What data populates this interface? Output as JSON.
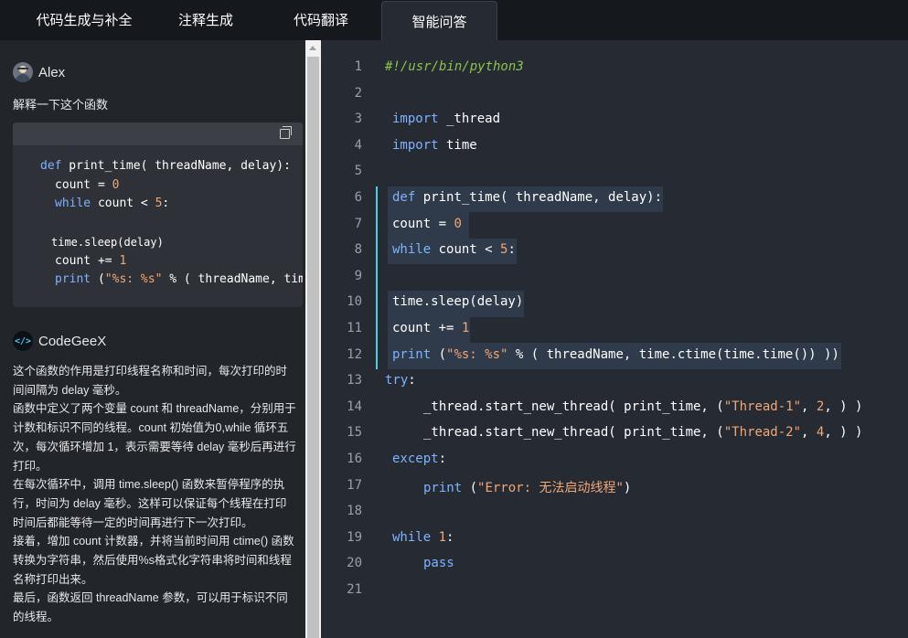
{
  "tabs": [
    {
      "label": "代码生成与补全",
      "active": false
    },
    {
      "label": "注释生成",
      "active": false
    },
    {
      "label": "代码翻译",
      "active": false
    },
    {
      "label": "智能问答",
      "active": true
    }
  ],
  "chat": {
    "user_name": "Alex",
    "question": "解释一下这个函数",
    "assistant_name": "CodeGeeX",
    "assistant_icon_text": "</>",
    "snippet_lines": [
      {
        "tokens": [
          {
            "t": "def",
            "c": "k"
          },
          {
            "t": " print_time( threadName, delay):",
            "c": "white"
          }
        ]
      },
      {
        "tokens": [
          {
            "t": "count = ",
            "c": "white"
          },
          {
            "t": "0",
            "c": "n"
          }
        ]
      },
      {
        "tokens": [
          {
            "t": "while",
            "c": "k"
          },
          {
            "t": " count < ",
            "c": "white"
          },
          {
            "t": "5",
            "c": "n"
          },
          {
            "t": ":",
            "c": "white"
          }
        ]
      },
      {
        "tokens": [
          {
            "t": "time.sleep(delay)",
            "c": "white"
          }
        ]
      },
      {
        "tokens": [
          {
            "t": "count += ",
            "c": "white"
          },
          {
            "t": "1",
            "c": "n"
          }
        ]
      },
      {
        "tokens": [
          {
            "t": "print",
            "c": "k"
          },
          {
            "t": " (",
            "c": "white"
          },
          {
            "t": "\"%s: %s\"",
            "c": "s"
          },
          {
            "t": " % ( threadName, time.ctime(time.time()) ))",
            "c": "white"
          }
        ]
      }
    ],
    "answer": [
      "这个函数的作用是打印线程名称和时间，每次打印的时间间隔为 delay 毫秒。",
      "函数中定义了两个变量 count 和 threadName，分别用于计数和标识不同的线程。count 初始值为0,while 循环五次，每次循环增加 1，表示需要等待 delay 毫秒后再进行打印。",
      "在每次循环中，调用 time.sleep() 函数来暂停程序的执行，时间为 delay 毫秒。这样可以保证每个线程在打印时间后都能等待一定的时间再进行下一次打印。",
      "接着，增加 count 计数器，并将当前时间用 ctime() 函数转换为字符串，然后使用%s格式化字符串将时间和线程名称打印出来。",
      "最后，函数返回 threadName 参数，可以用于标识不同的线程。"
    ]
  },
  "editor": {
    "lines": [
      {
        "num": "1",
        "tokens": [
          {
            "t": "#!/usr/bin/python3",
            "c": "c"
          }
        ]
      },
      {
        "num": "2",
        "tokens": []
      },
      {
        "num": "3",
        "tokens": [
          {
            "t": "import",
            "c": "k"
          },
          {
            "t": " _thread",
            "c": "white"
          }
        ]
      },
      {
        "num": "4",
        "tokens": [
          {
            "t": "import",
            "c": "k"
          },
          {
            "t": " time",
            "c": "white"
          }
        ]
      },
      {
        "num": "5",
        "tokens": []
      },
      {
        "num": "6",
        "tokens": [
          {
            "t": "def",
            "c": "k"
          },
          {
            "t": " print_time( threadName, delay):",
            "c": "white"
          }
        ]
      },
      {
        "num": "7",
        "tokens": [
          {
            "t": "count = ",
            "c": "white"
          },
          {
            "t": "0",
            "c": "n"
          }
        ]
      },
      {
        "num": "8",
        "tokens": [
          {
            "t": "while",
            "c": "k"
          },
          {
            "t": " count < ",
            "c": "white"
          },
          {
            "t": "5",
            "c": "n"
          },
          {
            "t": ":",
            "c": "white"
          }
        ]
      },
      {
        "num": "9",
        "tokens": []
      },
      {
        "num": "10",
        "tokens": [
          {
            "t": "time.sleep(delay)",
            "c": "white"
          }
        ]
      },
      {
        "num": "11",
        "tokens": [
          {
            "t": "count += ",
            "c": "white"
          },
          {
            "t": "1",
            "c": "n"
          }
        ]
      },
      {
        "num": "12",
        "tokens": [
          {
            "t": "print",
            "c": "k"
          },
          {
            "t": " (",
            "c": "white"
          },
          {
            "t": "\"%s: %s\"",
            "c": "s"
          },
          {
            "t": " % ( threadName, time.ctime(time.time()) ))",
            "c": "white"
          }
        ]
      },
      {
        "num": "13",
        "tokens": [
          {
            "t": "try",
            "c": "k"
          },
          {
            "t": ":",
            "c": "white"
          }
        ]
      },
      {
        "num": "14",
        "tokens": [
          {
            "t": "_thread.start_new_thread( print_time, (",
            "c": "white"
          },
          {
            "t": "\"Thread-1\"",
            "c": "s"
          },
          {
            "t": ", ",
            "c": "white"
          },
          {
            "t": "2",
            "c": "n"
          },
          {
            "t": ", ) )",
            "c": "white"
          }
        ]
      },
      {
        "num": "15",
        "tokens": [
          {
            "t": "_thread.start_new_thread( print_time, (",
            "c": "white"
          },
          {
            "t": "\"Thread-2\"",
            "c": "s"
          },
          {
            "t": ", ",
            "c": "white"
          },
          {
            "t": "4",
            "c": "n"
          },
          {
            "t": ", ) )",
            "c": "white"
          }
        ]
      },
      {
        "num": "16",
        "tokens": [
          {
            "t": "except",
            "c": "k"
          },
          {
            "t": ":",
            "c": "white"
          }
        ]
      },
      {
        "num": "17",
        "tokens": [
          {
            "t": "print",
            "c": "k"
          },
          {
            "t": " (",
            "c": "white"
          },
          {
            "t": "\"Error: 无法启动线程\"",
            "c": "s"
          },
          {
            "t": ")",
            "c": "white"
          }
        ]
      },
      {
        "num": "18",
        "tokens": []
      },
      {
        "num": "19",
        "tokens": [
          {
            "t": "while",
            "c": "k"
          },
          {
            "t": " ",
            "c": "white"
          },
          {
            "t": "1",
            "c": "n"
          },
          {
            "t": ":",
            "c": "white"
          }
        ]
      },
      {
        "num": "20",
        "tokens": [
          {
            "t": "pass",
            "c": "k"
          }
        ]
      },
      {
        "num": "21",
        "tokens": []
      }
    ]
  }
}
